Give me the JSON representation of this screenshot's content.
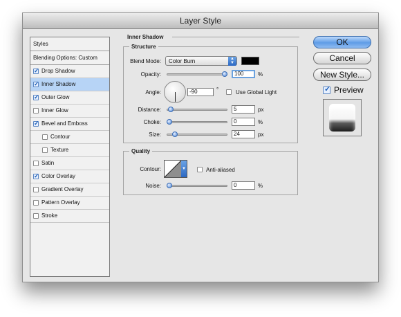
{
  "window": {
    "title": "Layer Style"
  },
  "sidebar": {
    "header": "Styles",
    "blending": "Blending Options: Custom",
    "items": [
      {
        "label": "Drop Shadow",
        "checked": true,
        "selected": false,
        "indent": false
      },
      {
        "label": "Inner Shadow",
        "checked": true,
        "selected": true,
        "indent": false
      },
      {
        "label": "Outer Glow",
        "checked": true,
        "selected": false,
        "indent": false
      },
      {
        "label": "Inner Glow",
        "checked": false,
        "selected": false,
        "indent": false
      },
      {
        "label": "Bevel and Emboss",
        "checked": true,
        "selected": false,
        "indent": false
      },
      {
        "label": "Contour",
        "checked": false,
        "selected": false,
        "indent": true
      },
      {
        "label": "Texture",
        "checked": false,
        "selected": false,
        "indent": true
      },
      {
        "label": "Satin",
        "checked": false,
        "selected": false,
        "indent": false
      },
      {
        "label": "Color Overlay",
        "checked": true,
        "selected": false,
        "indent": false
      },
      {
        "label": "Gradient Overlay",
        "checked": false,
        "selected": false,
        "indent": false
      },
      {
        "label": "Pattern Overlay",
        "checked": false,
        "selected": false,
        "indent": false
      },
      {
        "label": "Stroke",
        "checked": false,
        "selected": false,
        "indent": false
      }
    ]
  },
  "inner_shadow": {
    "title": "Inner Shadow",
    "structure": {
      "title": "Structure",
      "blend_mode_label": "Blend Mode:",
      "blend_mode_value": "Color Burn",
      "blend_color": "#000000",
      "opacity_label": "Opacity:",
      "opacity_value": "100",
      "opacity_unit": "%",
      "opacity_fraction": 1.0,
      "angle_label": "Angle:",
      "angle_value": "-90",
      "angle_degrees": -90,
      "degree_symbol": "°",
      "use_global_light_label": "Use Global Light",
      "use_global_light": false,
      "distance_label": "Distance:",
      "distance_value": "5",
      "distance_unit": "px",
      "distance_fraction": 0.02,
      "choke_label": "Choke:",
      "choke_value": "0",
      "choke_unit": "%",
      "choke_fraction": 0.0,
      "size_label": "Size:",
      "size_value": "24",
      "size_unit": "px",
      "size_fraction": 0.1
    },
    "quality": {
      "title": "Quality",
      "contour_label": "Contour:",
      "anti_aliased_label": "Anti-aliased",
      "anti_aliased": false,
      "noise_label": "Noise:",
      "noise_value": "0",
      "noise_unit": "%",
      "noise_fraction": 0.0
    }
  },
  "buttons": {
    "ok": "OK",
    "cancel": "Cancel",
    "new_style": "New Style..."
  },
  "preview": {
    "label": "Preview",
    "checked": true
  }
}
